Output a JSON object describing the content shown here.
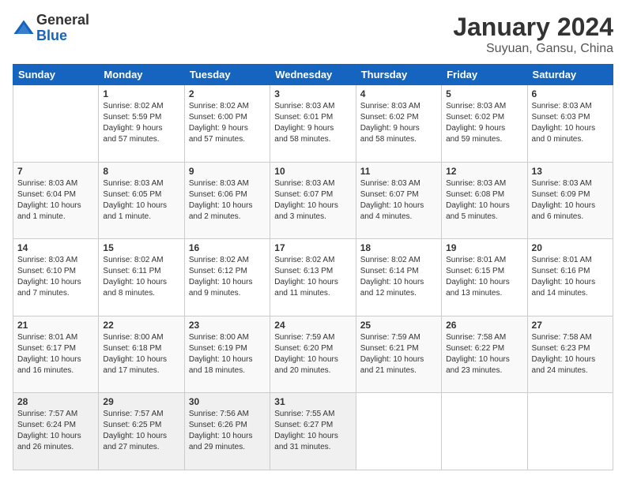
{
  "app": {
    "logo_line1": "General",
    "logo_line2": "Blue"
  },
  "header": {
    "title": "January 2024",
    "subtitle": "Suyuan, Gansu, China"
  },
  "weekdays": [
    "Sunday",
    "Monday",
    "Tuesday",
    "Wednesday",
    "Thursday",
    "Friday",
    "Saturday"
  ],
  "weeks": [
    [
      {
        "day": "",
        "info": ""
      },
      {
        "day": "1",
        "info": "Sunrise: 8:02 AM\nSunset: 5:59 PM\nDaylight: 9 hours\nand 57 minutes."
      },
      {
        "day": "2",
        "info": "Sunrise: 8:02 AM\nSunset: 6:00 PM\nDaylight: 9 hours\nand 57 minutes."
      },
      {
        "day": "3",
        "info": "Sunrise: 8:03 AM\nSunset: 6:01 PM\nDaylight: 9 hours\nand 58 minutes."
      },
      {
        "day": "4",
        "info": "Sunrise: 8:03 AM\nSunset: 6:02 PM\nDaylight: 9 hours\nand 58 minutes."
      },
      {
        "day": "5",
        "info": "Sunrise: 8:03 AM\nSunset: 6:02 PM\nDaylight: 9 hours\nand 59 minutes."
      },
      {
        "day": "6",
        "info": "Sunrise: 8:03 AM\nSunset: 6:03 PM\nDaylight: 10 hours\nand 0 minutes."
      }
    ],
    [
      {
        "day": "7",
        "info": "Sunrise: 8:03 AM\nSunset: 6:04 PM\nDaylight: 10 hours\nand 1 minute."
      },
      {
        "day": "8",
        "info": "Sunrise: 8:03 AM\nSunset: 6:05 PM\nDaylight: 10 hours\nand 1 minute."
      },
      {
        "day": "9",
        "info": "Sunrise: 8:03 AM\nSunset: 6:06 PM\nDaylight: 10 hours\nand 2 minutes."
      },
      {
        "day": "10",
        "info": "Sunrise: 8:03 AM\nSunset: 6:07 PM\nDaylight: 10 hours\nand 3 minutes."
      },
      {
        "day": "11",
        "info": "Sunrise: 8:03 AM\nSunset: 6:07 PM\nDaylight: 10 hours\nand 4 minutes."
      },
      {
        "day": "12",
        "info": "Sunrise: 8:03 AM\nSunset: 6:08 PM\nDaylight: 10 hours\nand 5 minutes."
      },
      {
        "day": "13",
        "info": "Sunrise: 8:03 AM\nSunset: 6:09 PM\nDaylight: 10 hours\nand 6 minutes."
      }
    ],
    [
      {
        "day": "14",
        "info": "Sunrise: 8:03 AM\nSunset: 6:10 PM\nDaylight: 10 hours\nand 7 minutes."
      },
      {
        "day": "15",
        "info": "Sunrise: 8:02 AM\nSunset: 6:11 PM\nDaylight: 10 hours\nand 8 minutes."
      },
      {
        "day": "16",
        "info": "Sunrise: 8:02 AM\nSunset: 6:12 PM\nDaylight: 10 hours\nand 9 minutes."
      },
      {
        "day": "17",
        "info": "Sunrise: 8:02 AM\nSunset: 6:13 PM\nDaylight: 10 hours\nand 11 minutes."
      },
      {
        "day": "18",
        "info": "Sunrise: 8:02 AM\nSunset: 6:14 PM\nDaylight: 10 hours\nand 12 minutes."
      },
      {
        "day": "19",
        "info": "Sunrise: 8:01 AM\nSunset: 6:15 PM\nDaylight: 10 hours\nand 13 minutes."
      },
      {
        "day": "20",
        "info": "Sunrise: 8:01 AM\nSunset: 6:16 PM\nDaylight: 10 hours\nand 14 minutes."
      }
    ],
    [
      {
        "day": "21",
        "info": "Sunrise: 8:01 AM\nSunset: 6:17 PM\nDaylight: 10 hours\nand 16 minutes."
      },
      {
        "day": "22",
        "info": "Sunrise: 8:00 AM\nSunset: 6:18 PM\nDaylight: 10 hours\nand 17 minutes."
      },
      {
        "day": "23",
        "info": "Sunrise: 8:00 AM\nSunset: 6:19 PM\nDaylight: 10 hours\nand 18 minutes."
      },
      {
        "day": "24",
        "info": "Sunrise: 7:59 AM\nSunset: 6:20 PM\nDaylight: 10 hours\nand 20 minutes."
      },
      {
        "day": "25",
        "info": "Sunrise: 7:59 AM\nSunset: 6:21 PM\nDaylight: 10 hours\nand 21 minutes."
      },
      {
        "day": "26",
        "info": "Sunrise: 7:58 AM\nSunset: 6:22 PM\nDaylight: 10 hours\nand 23 minutes."
      },
      {
        "day": "27",
        "info": "Sunrise: 7:58 AM\nSunset: 6:23 PM\nDaylight: 10 hours\nand 24 minutes."
      }
    ],
    [
      {
        "day": "28",
        "info": "Sunrise: 7:57 AM\nSunset: 6:24 PM\nDaylight: 10 hours\nand 26 minutes."
      },
      {
        "day": "29",
        "info": "Sunrise: 7:57 AM\nSunset: 6:25 PM\nDaylight: 10 hours\nand 27 minutes."
      },
      {
        "day": "30",
        "info": "Sunrise: 7:56 AM\nSunset: 6:26 PM\nDaylight: 10 hours\nand 29 minutes."
      },
      {
        "day": "31",
        "info": "Sunrise: 7:55 AM\nSunset: 6:27 PM\nDaylight: 10 hours\nand 31 minutes."
      },
      {
        "day": "",
        "info": ""
      },
      {
        "day": "",
        "info": ""
      },
      {
        "day": "",
        "info": ""
      }
    ]
  ]
}
